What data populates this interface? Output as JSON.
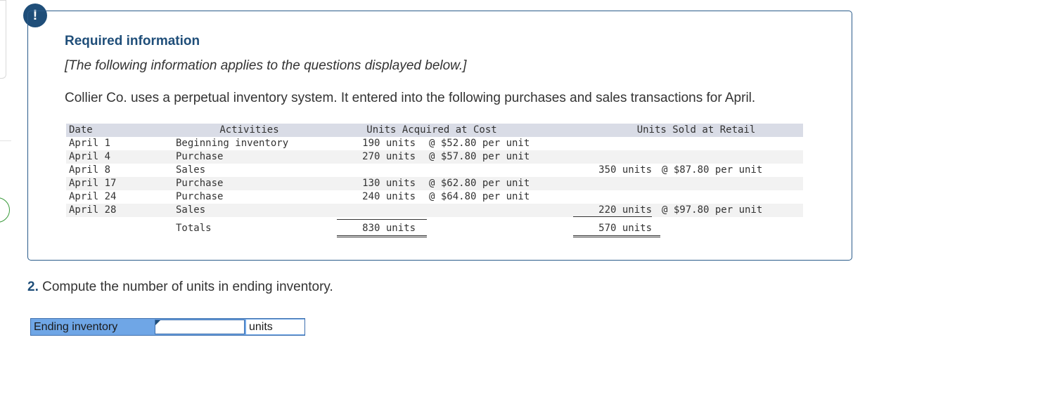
{
  "alert": {
    "icon": "exclamation-icon",
    "glyph": "!"
  },
  "info": {
    "title": "Required information",
    "applies_text": "[The following information applies to the questions displayed below.]",
    "intro": "Collier Co. uses a perpetual inventory system. It entered into the following purchases and sales transactions for April."
  },
  "table": {
    "headers": {
      "date": "Date",
      "activities": "Activities",
      "acquired": "Units Acquired at Cost",
      "sold": "Units Sold at Retail"
    },
    "rows": [
      {
        "date": "April 1",
        "activity": "Beginning inventory",
        "acq_units": "190 units",
        "acq_cost": "@ $52.80 per unit",
        "sold_units": "",
        "sold_price": ""
      },
      {
        "date": "April 4",
        "activity": "Purchase",
        "acq_units": "270 units",
        "acq_cost": "@ $57.80 per unit",
        "sold_units": "",
        "sold_price": ""
      },
      {
        "date": "April 8",
        "activity": "Sales",
        "acq_units": "",
        "acq_cost": "",
        "sold_units": "350 units",
        "sold_price": "@ $87.80 per unit"
      },
      {
        "date": "April 17",
        "activity": "Purchase",
        "acq_units": "130 units",
        "acq_cost": "@ $62.80 per unit",
        "sold_units": "",
        "sold_price": ""
      },
      {
        "date": "April 24",
        "activity": "Purchase",
        "acq_units": "240 units",
        "acq_cost": "@ $64.80 per unit",
        "sold_units": "",
        "sold_price": ""
      },
      {
        "date": "April 28",
        "activity": "Sales",
        "acq_units": "",
        "acq_cost": "",
        "sold_units": "220 units",
        "sold_price": "@ $97.80 per unit"
      }
    ],
    "totals": {
      "label": "Totals",
      "acq_units": "830 units",
      "sold_units": "570 units"
    }
  },
  "question": {
    "number": "2.",
    "text": " Compute the number of units in ending inventory."
  },
  "answer": {
    "label": "Ending inventory",
    "value": "",
    "unit": "units"
  }
}
